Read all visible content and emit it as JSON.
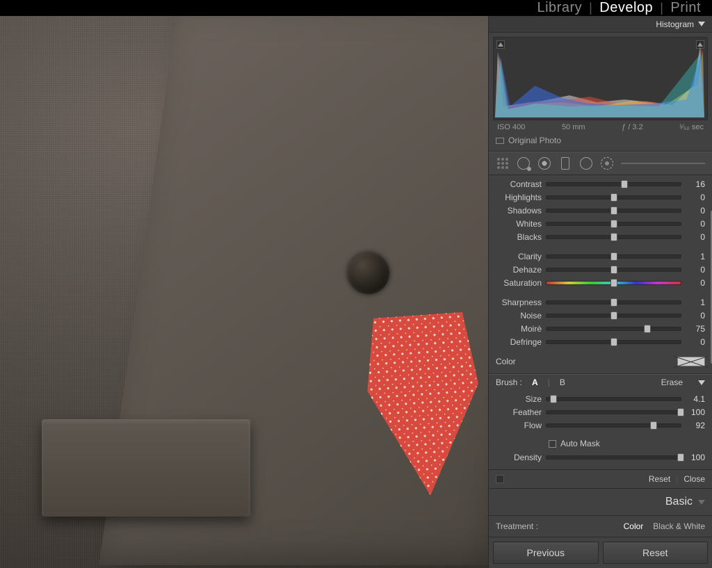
{
  "nav": {
    "library": "Library",
    "develop": "Develop",
    "print": "Print"
  },
  "panel": {
    "histogram_label": "Histogram",
    "meta": {
      "iso": "ISO 400",
      "focal": "50 mm",
      "aperture": "ƒ / 3.2",
      "shutter": "¹⁄₅₀ sec"
    },
    "original_photo": "Original Photo"
  },
  "sliders": {
    "contrast": {
      "label": "Contrast",
      "value": "16",
      "pos": 58
    },
    "highlights": {
      "label": "Highlights",
      "value": "0",
      "pos": 50
    },
    "shadows": {
      "label": "Shadows",
      "value": "0",
      "pos": 50
    },
    "whites": {
      "label": "Whites",
      "value": "0",
      "pos": 50
    },
    "blacks": {
      "label": "Blacks",
      "value": "0",
      "pos": 50
    },
    "clarity": {
      "label": "Clarity",
      "value": "1",
      "pos": 50
    },
    "dehaze": {
      "label": "Dehaze",
      "value": "0",
      "pos": 50
    },
    "saturation": {
      "label": "Saturation",
      "value": "0",
      "pos": 50
    },
    "sharpness": {
      "label": "Sharpness",
      "value": "1",
      "pos": 50
    },
    "noise": {
      "label": "Noise",
      "value": "0",
      "pos": 50
    },
    "moire": {
      "label": "Moirè",
      "value": "75",
      "pos": 75
    },
    "defringe": {
      "label": "Defringe",
      "value": "0",
      "pos": 50
    }
  },
  "color_row": {
    "label": "Color"
  },
  "brush": {
    "header": "Brush :",
    "tabA": "A",
    "tabB": "B",
    "erase": "Erase",
    "size": {
      "label": "Size",
      "value": "4.1",
      "pos": 5
    },
    "feather": {
      "label": "Feather",
      "value": "100",
      "pos": 100
    },
    "flow": {
      "label": "Flow",
      "value": "92",
      "pos": 80
    },
    "automask": {
      "label": "Auto Mask"
    },
    "density": {
      "label": "Density",
      "value": "100",
      "pos": 100
    }
  },
  "resetclose": {
    "reset": "Reset",
    "close": "Close"
  },
  "basic": {
    "label": "Basic"
  },
  "treatment": {
    "label": "Treatment :",
    "color": "Color",
    "bw": "Black & White"
  },
  "footer": {
    "previous": "Previous",
    "reset": "Reset"
  }
}
